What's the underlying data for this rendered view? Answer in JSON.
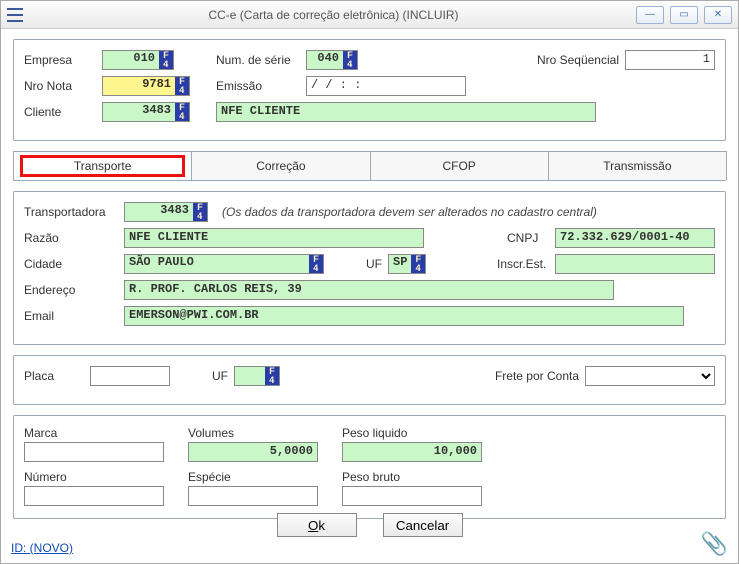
{
  "window": {
    "title": "CC-e (Carta de correção eletrônica)  (INCLUIR)"
  },
  "header": {
    "empresa_label": "Empresa",
    "empresa": "010",
    "nro_nota_label": "Nro Nota",
    "nro_nota": "9781",
    "cliente_label": "Cliente",
    "cliente": "3483",
    "num_serie_label": "Num. de série",
    "num_serie": "040",
    "emissao_label": "Emissão",
    "emissao": "  /  /        :  :",
    "nro_sequencial_label": "Nro Seqüencial",
    "nro_sequencial": "1",
    "cliente_nome": "NFE CLIENTE"
  },
  "tabs": {
    "transporte": "Transporte",
    "correcao": "Correção",
    "cfop": "CFOP",
    "transmissao": "Transmissão"
  },
  "transporte": {
    "transportadora_label": "Transportadora",
    "transportadora": "3483",
    "hint": "(Os dados da transportadora devem ser alterados no cadastro central)",
    "razao_label": "Razão",
    "razao": "NFE CLIENTE",
    "cnpj_label": "CNPJ",
    "cnpj": "72.332.629/0001-40",
    "cidade_label": "Cidade",
    "cidade": "SÃO PAULO",
    "uf_label": "UF",
    "uf": "SP",
    "inscr_label": "Inscr.Est.",
    "inscr": "",
    "endereco_label": "Endereço",
    "endereco": "R. PROF. CARLOS REIS, 39",
    "email_label": "Email",
    "email": "EMERSON@PWI.COM.BR",
    "placa_label": "Placa",
    "placa": "",
    "placa_uf_label": "UF",
    "placa_uf": "",
    "frete_label": "Frete por Conta",
    "frete": "",
    "marca_label": "Marca",
    "marca": "",
    "volumes_label": "Volumes",
    "volumes": "5,0000",
    "peso_liq_label": "Peso liquido",
    "peso_liq": "10,000",
    "numero_label": "Número",
    "numero": "",
    "especie_label": "Espécie",
    "especie": "",
    "peso_bruto_label": "Peso bruto",
    "peso_bruto": ""
  },
  "footer": {
    "ok": "Ok",
    "cancelar": "Cancelar",
    "id": "ID: (NOVO)"
  }
}
